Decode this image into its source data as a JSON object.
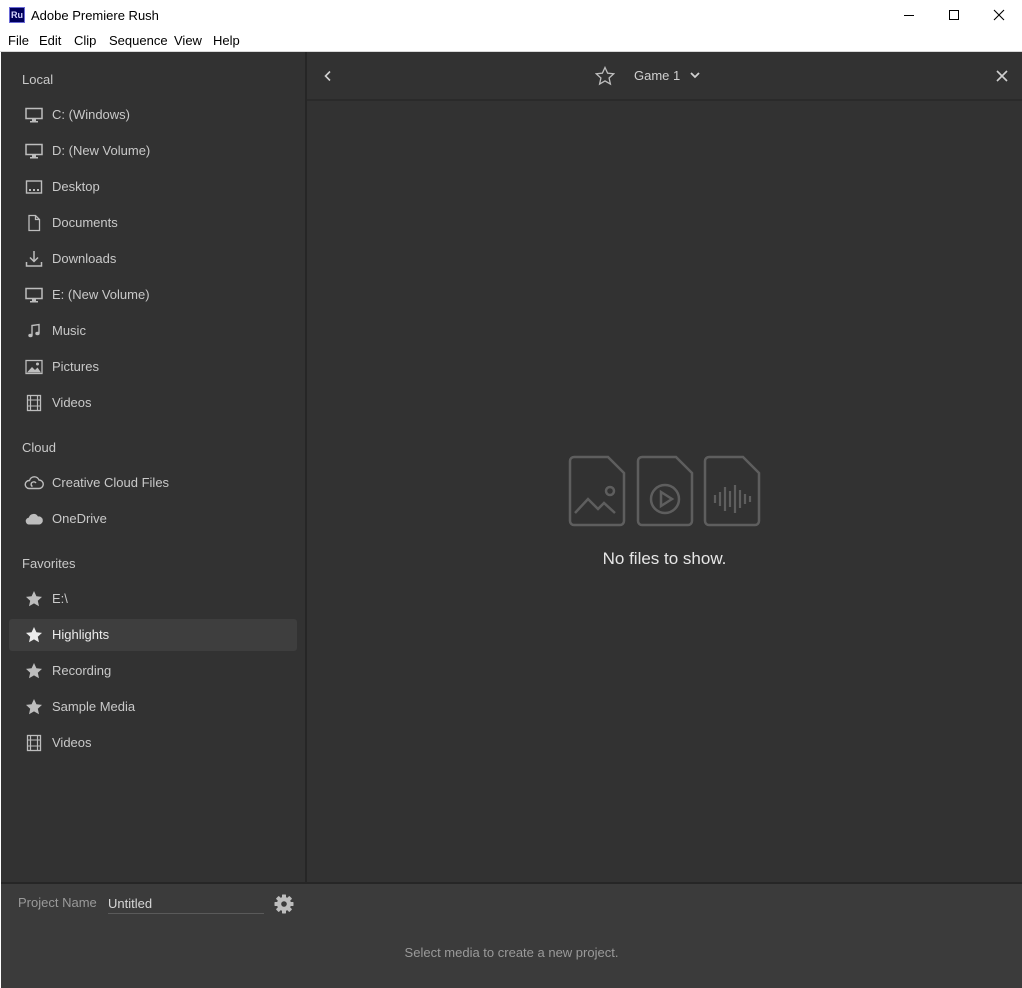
{
  "window": {
    "app_icon_text": "Ru",
    "title": "Adobe Premiere Rush",
    "controls": [
      "minimize-icon",
      "maximize-icon",
      "close-icon"
    ]
  },
  "menu": {
    "items": [
      "File",
      "Edit",
      "Clip",
      "Sequence",
      "View",
      "Help"
    ]
  },
  "sidebar": {
    "sections": [
      {
        "title": "Local",
        "items": [
          {
            "label": "C: (Windows)",
            "icon": "monitor-icon"
          },
          {
            "label": "D: (New Volume)",
            "icon": "monitor-icon"
          },
          {
            "label": "Desktop",
            "icon": "desktop-icon"
          },
          {
            "label": "Documents",
            "icon": "document-icon"
          },
          {
            "label": "Downloads",
            "icon": "download-icon"
          },
          {
            "label": "E: (New Volume)",
            "icon": "monitor-icon"
          },
          {
            "label": "Music",
            "icon": "music-note-icon"
          },
          {
            "label": "Pictures",
            "icon": "picture-icon"
          },
          {
            "label": "Videos",
            "icon": "film-icon"
          }
        ]
      },
      {
        "title": "Cloud",
        "items": [
          {
            "label": "Creative Cloud Files",
            "icon": "creative-cloud-icon"
          },
          {
            "label": "OneDrive",
            "icon": "cloud-icon"
          }
        ]
      },
      {
        "title": "Favorites",
        "items": [
          {
            "label": "E:\\",
            "icon": "star-icon"
          },
          {
            "label": "Highlights",
            "icon": "star-icon",
            "selected": true
          },
          {
            "label": "Recording",
            "icon": "star-icon"
          },
          {
            "label": "Sample Media",
            "icon": "star-icon"
          },
          {
            "label": "Videos",
            "icon": "film-icon"
          }
        ]
      }
    ]
  },
  "browser": {
    "folder_name": "Game 1",
    "empty_message": "No files to show.",
    "placeholder_icons": [
      "image-file-icon",
      "video-file-icon",
      "audio-file-icon"
    ]
  },
  "project": {
    "name_label": "Project Name",
    "name_value": "Untitled",
    "hint": "Select media to create a new project."
  },
  "colors": {
    "panel_bg": "#323232",
    "selected_bg": "#3e3e3e",
    "bottom_bg": "#3b3b3b",
    "text": "#c9c9c9",
    "icon": "#bdbdbd"
  }
}
